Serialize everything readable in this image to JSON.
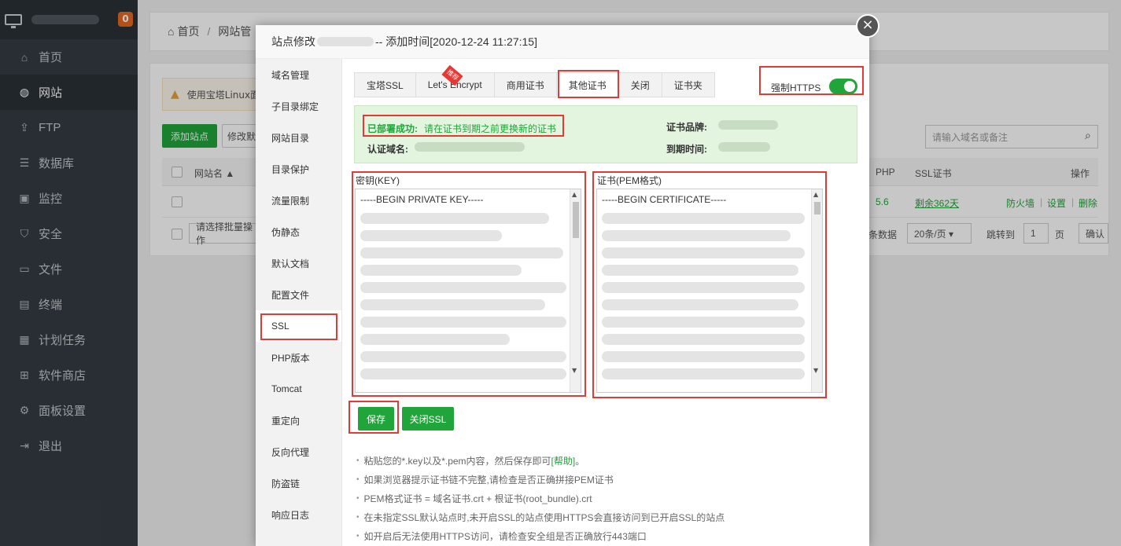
{
  "sidebar": {
    "badge": "0",
    "items": [
      {
        "label": "首页",
        "icon": "home-icon",
        "glyph": "⌂"
      },
      {
        "label": "网站",
        "icon": "globe-icon",
        "glyph": "◍"
      },
      {
        "label": "FTP",
        "icon": "ftp-icon",
        "glyph": "⇪"
      },
      {
        "label": "数据库",
        "icon": "database-icon",
        "glyph": "☰"
      },
      {
        "label": "监控",
        "icon": "monitor-icon",
        "glyph": "▣"
      },
      {
        "label": "安全",
        "icon": "shield-icon",
        "glyph": "⛉"
      },
      {
        "label": "文件",
        "icon": "folder-icon",
        "glyph": "▭"
      },
      {
        "label": "终端",
        "icon": "terminal-icon",
        "glyph": "▤"
      },
      {
        "label": "计划任务",
        "icon": "calendar-icon",
        "glyph": "▦"
      },
      {
        "label": "软件商店",
        "icon": "apps-icon",
        "glyph": "⊞"
      },
      {
        "label": "面板设置",
        "icon": "settings-icon",
        "glyph": "⚙"
      },
      {
        "label": "退出",
        "icon": "logout-icon",
        "glyph": "⇥"
      }
    ],
    "active_index": 1
  },
  "breadcrumb": {
    "home": "首页",
    "current": "网站管"
  },
  "background": {
    "warning": "使用宝塔Linux面",
    "add_site": "添加站点",
    "modify": "修改默",
    "search_placeholder": "请输入域名或备注",
    "col_site": "网站名 ▲",
    "col_php": "PHP",
    "col_ssl": "SSL证书",
    "col_ops": "操作",
    "row_php": "5.6",
    "row_ssl": "剩余362天",
    "op_firewall": "防火墙",
    "op_settings": "设置",
    "op_delete": "删除",
    "batch_placeholder": "请选择批量操作",
    "records": "条数据",
    "page_size": "20条/页 ▾",
    "jump_to": "跳转到",
    "page_num": "1",
    "page_unit": "页",
    "confirm": "确认"
  },
  "modal": {
    "title_prefix": "站点修改",
    "title_suffix": "-- 添加时间[2020-12-24 11:27:15]",
    "close": "×",
    "side_items": [
      "域名管理",
      "子目录绑定",
      "网站目录",
      "目录保护",
      "流量限制",
      "伪静态",
      "默认文档",
      "配置文件",
      "SSL",
      "PHP版本",
      "Tomcat",
      "重定向",
      "反向代理",
      "防盗链",
      "响应日志"
    ],
    "side_active": 8,
    "tabs": [
      "宝塔SSL",
      "Let's Encrypt",
      "商用证书",
      "其他证书",
      "关闭",
      "证书夹"
    ],
    "tab_active": 3,
    "ribbon": "推荐",
    "force_https_label": "强制HTTPS",
    "force_https_on": true,
    "status_label": "已部署成功:",
    "status_text": "请在证书到期之前更换新的证书",
    "domain_label": "认证域名:",
    "brand_label": "证书品牌:",
    "expire_label": "到期时间:",
    "key_label": "密钥(KEY)",
    "key_first_line": "-----BEGIN PRIVATE KEY-----",
    "cert_label": "证书(PEM格式)",
    "cert_first_line": "-----BEGIN CERTIFICATE-----",
    "save": "保存",
    "close_ssl": "关闭SSL",
    "tips": [
      {
        "text": "粘贴您的*.key以及*.pem内容，然后保存即可",
        "help": "[帮助]",
        "end": "。"
      },
      {
        "text": "如果浏览器提示证书链不完整,请检查是否正确拼接PEM证书",
        "help": "",
        "end": ""
      },
      {
        "text": "PEM格式证书 = 域名证书.crt + 根证书(root_bundle).crt",
        "help": "",
        "end": ""
      },
      {
        "text": "在未指定SSL默认站点时,未开启SSL的站点使用HTTPS会直接访问到已开启SSL的站点",
        "help": "",
        "end": ""
      },
      {
        "text": "如开启后无法使用HTTPS访问，请检查安全组是否正确放行443端口",
        "help": "",
        "end": ""
      }
    ]
  },
  "colors": {
    "accent": "#20a53a",
    "highlight": "#e53935",
    "sidebar": "#353c44"
  }
}
